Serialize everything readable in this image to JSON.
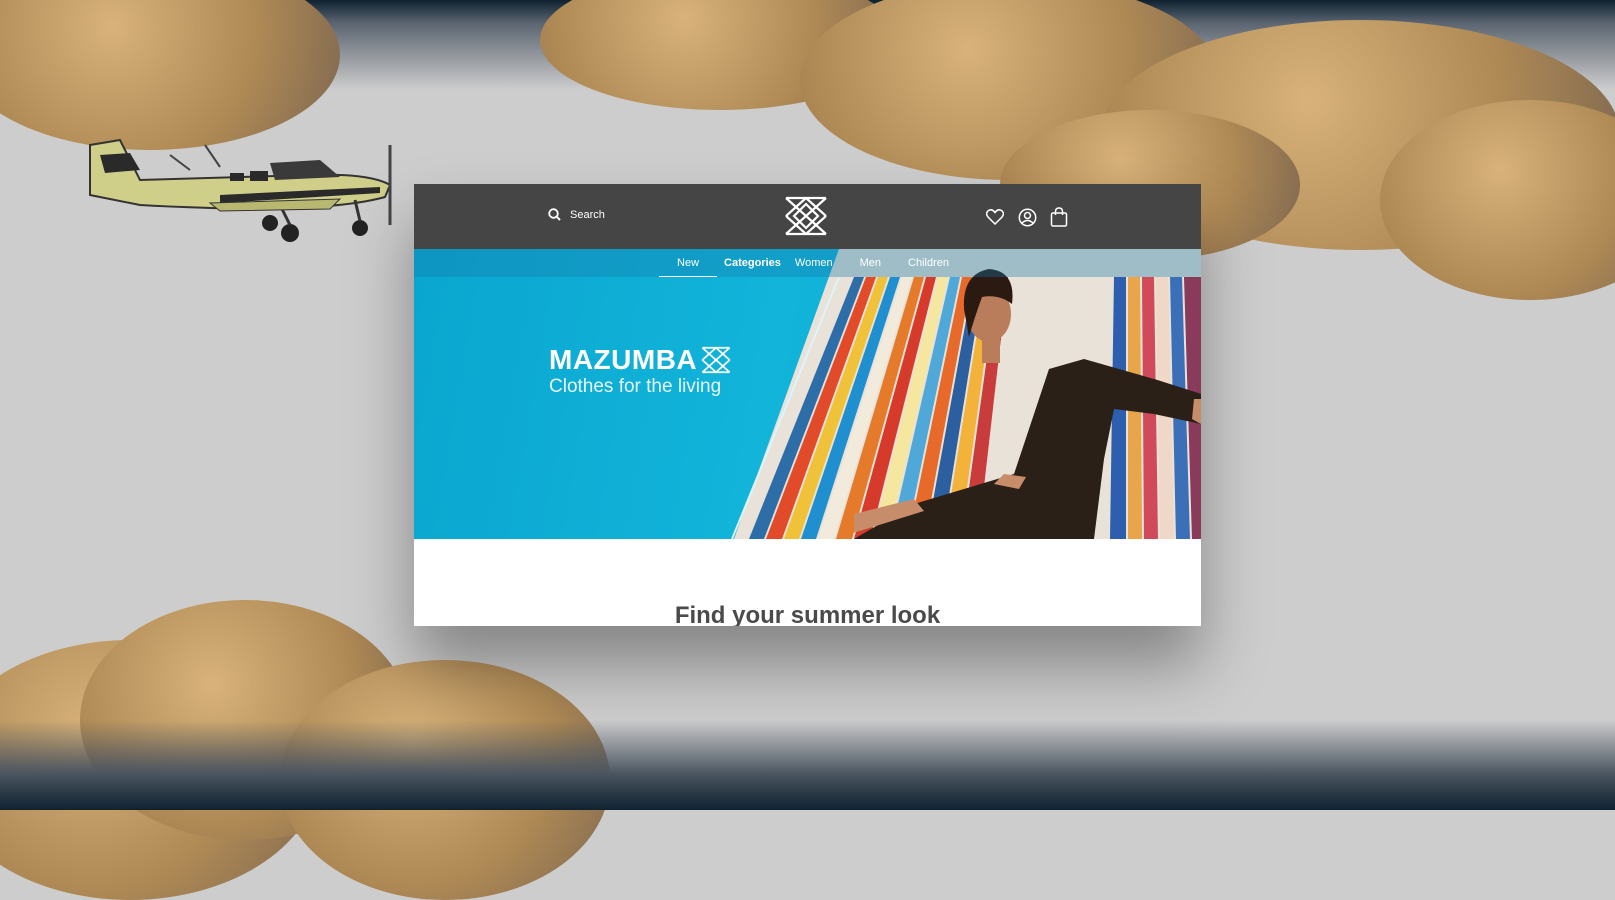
{
  "header": {
    "search_placeholder": "Search",
    "icons": [
      "search-icon",
      "brand-logo",
      "heart-icon",
      "account-icon",
      "bag-icon"
    ]
  },
  "nav": {
    "items": [
      {
        "label": "New",
        "active": true
      },
      {
        "label": "Categories"
      },
      {
        "label": "Women"
      },
      {
        "label": "Men"
      },
      {
        "label": "Children"
      }
    ]
  },
  "hero": {
    "brand": "MAZUMBA",
    "tagline": "Clothes for the living"
  },
  "section": {
    "title": "Find your summer look"
  },
  "colors": {
    "header_bg": "#454545",
    "hero_bg": "#12b4da",
    "text_dark": "#4a4a4a"
  }
}
